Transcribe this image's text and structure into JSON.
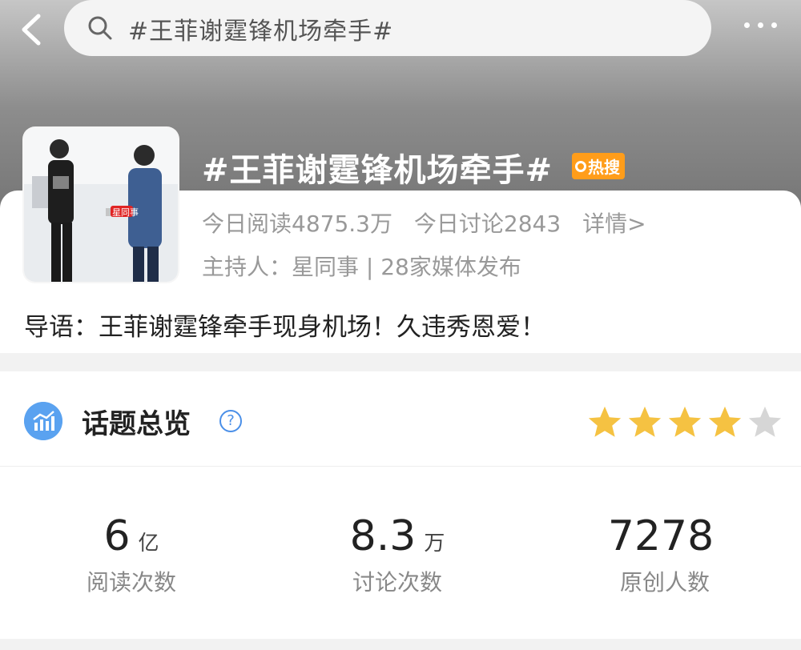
{
  "header": {
    "search_text": "#王菲谢霆锋机场牵手#"
  },
  "topic": {
    "title": "#王菲谢霆锋机场牵手#",
    "hot_badge": "热搜",
    "today_read": "今日阅读4875.3万",
    "today_discuss": "今日讨论2843",
    "details_link": "详情>",
    "host_line": "主持人：星同事 | 28家媒体发布",
    "thumb_watermark": "星同事",
    "guide": "导语：王菲谢霆锋牵手现身机场！久违秀恩爱！"
  },
  "overview": {
    "title": "话题总览",
    "help": "?",
    "rating": 4,
    "rating_max": 5,
    "metrics": [
      {
        "value": "6",
        "unit": "亿",
        "label": "阅读次数"
      },
      {
        "value": "8.3",
        "unit": "万",
        "label": "讨论次数"
      },
      {
        "value": "7278",
        "unit": "",
        "label": "原创人数"
      }
    ]
  },
  "colors": {
    "accent_blue": "#4a8fe8",
    "hot_orange": "#ff9d1a",
    "star_gold": "#f5c242",
    "star_gray": "#d6d6d6"
  }
}
